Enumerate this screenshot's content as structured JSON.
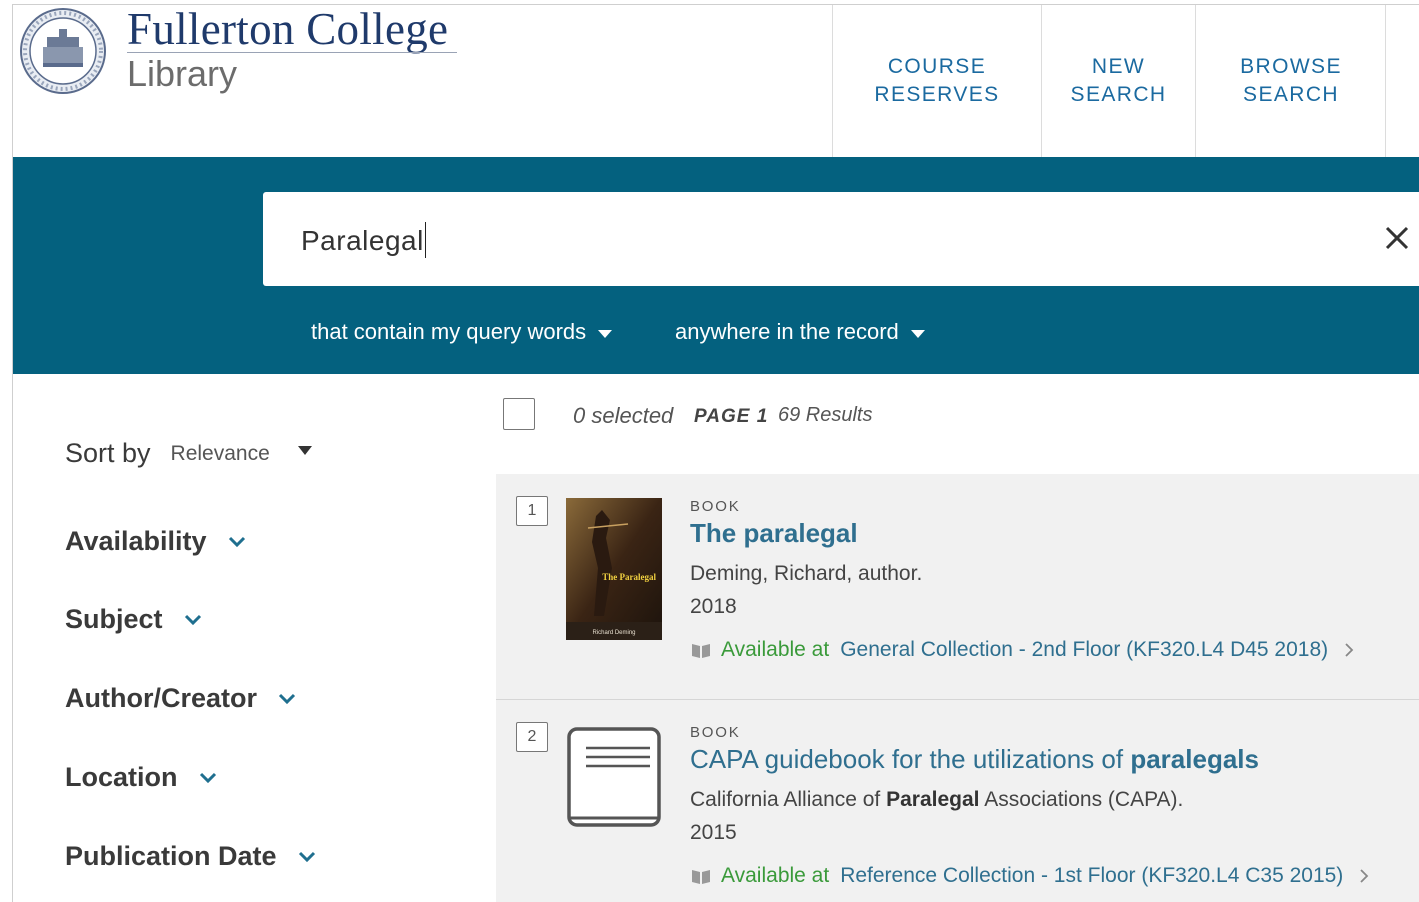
{
  "header": {
    "logo_title": "Fullerton College",
    "logo_subtitle": "Library",
    "nav": [
      {
        "line1": "COURSE",
        "line2": "RESERVES"
      },
      {
        "line1": "NEW",
        "line2": "SEARCH"
      },
      {
        "line1": "BROWSE",
        "line2": "SEARCH"
      }
    ]
  },
  "search": {
    "query": "Paralegal",
    "scope_match": "that contain my query words",
    "scope_field": "anywhere in the record"
  },
  "sidebar": {
    "sort_label": "Sort by",
    "sort_value": "Relevance",
    "facets": [
      "Availability",
      "Subject",
      "Author/Creator",
      "Location",
      "Publication Date"
    ]
  },
  "results_header": {
    "selected": "0 selected",
    "page": "PAGE 1",
    "count": "69 Results"
  },
  "results": [
    {
      "number": "1",
      "type": "BOOK",
      "title": "The paralegal",
      "author": "Deming, Richard, author.",
      "year": "2018",
      "status": "Available at",
      "location": "General Collection - 2nd Floor (KF320.L4 D45 2018)",
      "cover_title": "The Paralegal",
      "cover_author": "Richard Deming"
    },
    {
      "number": "2",
      "type": "BOOK",
      "title_pre": "CAPA guidebook for the utilizations of ",
      "title_bold": "paralegals",
      "author_pre": "California Alliance of ",
      "author_bold": "Paralegal",
      "author_post": " Associations (CAPA).",
      "year": "2015",
      "status": "Available at",
      "location": "Reference Collection - 1st Floor (KF320.L4 C35 2015)"
    }
  ],
  "colors": {
    "band": "#04617f",
    "link": "#2f6f8f",
    "available": "#3a9a3a",
    "nav": "#1b6aa0"
  }
}
